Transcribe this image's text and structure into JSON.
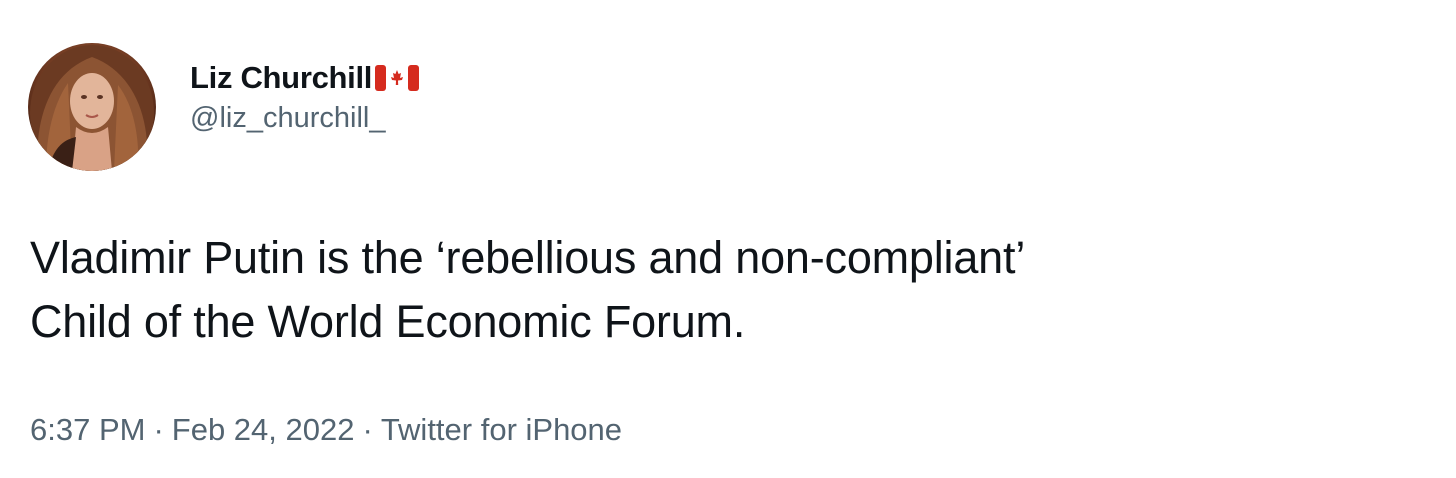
{
  "author": {
    "display_name": "Liz Churchill",
    "flag_icon": "canada-flag-icon",
    "handle": "@liz_churchill_"
  },
  "tweet": {
    "text_lines": [
      "Vladimir Putin is the ‘rebellious and non-compliant’",
      "Child of the World Economic Forum."
    ]
  },
  "meta": {
    "time": "6:37 PM",
    "separator": "·",
    "date": "Feb 24, 2022",
    "source": "Twitter for iPhone"
  },
  "colors": {
    "text_primary": "#0f1419",
    "text_secondary": "#536471",
    "flag_red": "#d52b1e"
  }
}
